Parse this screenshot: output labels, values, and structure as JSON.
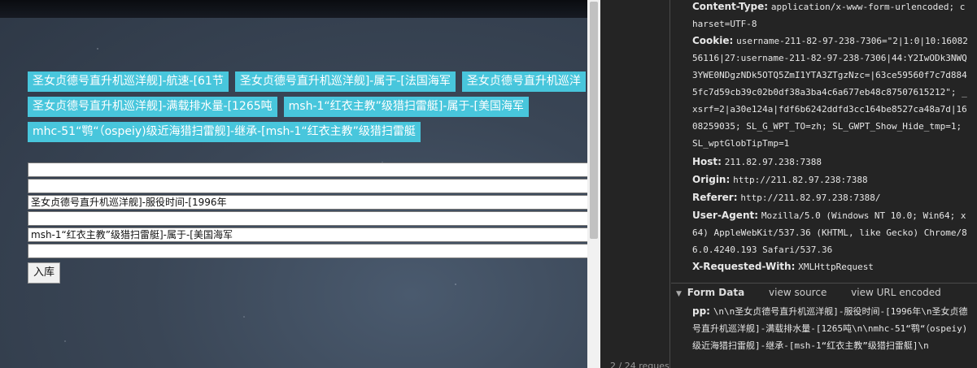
{
  "page": {
    "tags_row1": [
      "圣女贞德号直升机巡洋舰]-航速-[61节",
      "圣女贞德号直升机巡洋舰]-属于-[法国海军",
      "圣女贞德号直升机巡洋"
    ],
    "tags_row2": [
      "圣女贞德号直升机巡洋舰]-满载排水量-[1265吨",
      "msh-1“红衣主教”级猎扫雷艇]-属于-[美国海军"
    ],
    "tags_row3": [
      "mhc-51“鹗“（ospeiy)级近海猎扫雷舰]-继承-[msh-1“红衣主教”级猎扫雷艇"
    ],
    "rows": [
      "",
      "",
      "圣女贞德号直升机巡洋舰]-服役时间-[1996年",
      "",
      "msh-1“红衣主教”级猎扫雷艇]-属于-[美国海军",
      ""
    ],
    "submit_label": "入库"
  },
  "devtools": {
    "request_count": "2 / 24 reques",
    "headers": {
      "content_type": {
        "key": "Content-Type:",
        "value": "application/x-www-form-urlencoded; charset=UTF-8"
      },
      "cookie": {
        "key": "Cookie:",
        "value": "username-211-82-97-238-7306=\"2|1:0|10:1608256116|27:username-211-82-97-238-7306|44:Y2IwODk3NWQ3YWE0NDgzNDk5OTQ5ZmI1YTA3ZTgzNzc=|63ce59560f7c7d8845fc7d59cb39c02b0df38a3ba4c6a677eb48c87507615212\"; _xsrf=2|a30e124a|fdf6b6242ddfd3cc164be8527ca48a7d|1608259035; SL_G_WPT_TO=zh; SL_GWPT_Show_Hide_tmp=1; SL_wptGlobTipTmp=1"
      },
      "host": {
        "key": "Host:",
        "value": "211.82.97.238:7388"
      },
      "origin": {
        "key": "Origin:",
        "value": "http://211.82.97.238:7388"
      },
      "referer": {
        "key": "Referer:",
        "value": "http://211.82.97.238:7388/"
      },
      "user_agent": {
        "key": "User-Agent:",
        "value": "Mozilla/5.0 (Windows NT 10.0; Win64; x64) AppleWebKit/537.36 (KHTML, like Gecko) Chrome/86.0.4240.193 Safari/537.36"
      },
      "x_requested_with": {
        "key": "X-Requested-With:",
        "value": "XMLHttpRequest"
      }
    },
    "form_data": {
      "title": "Form Data",
      "view_source": "view source",
      "view_url_encoded": "view URL encoded",
      "pp_key": "pp:",
      "pp_value": "\\n\\n圣女贞德号直升机巡洋舰]-服役时间-[1996年\\n圣女贞德号直升机巡洋舰]-满载排水量-[1265吨\\n\\nmhc-51“鹗“（ospeiy)级近海猎扫雷舰]-继承-[msh-1“红衣主教”级猎扫雷艇]\\n"
    }
  }
}
